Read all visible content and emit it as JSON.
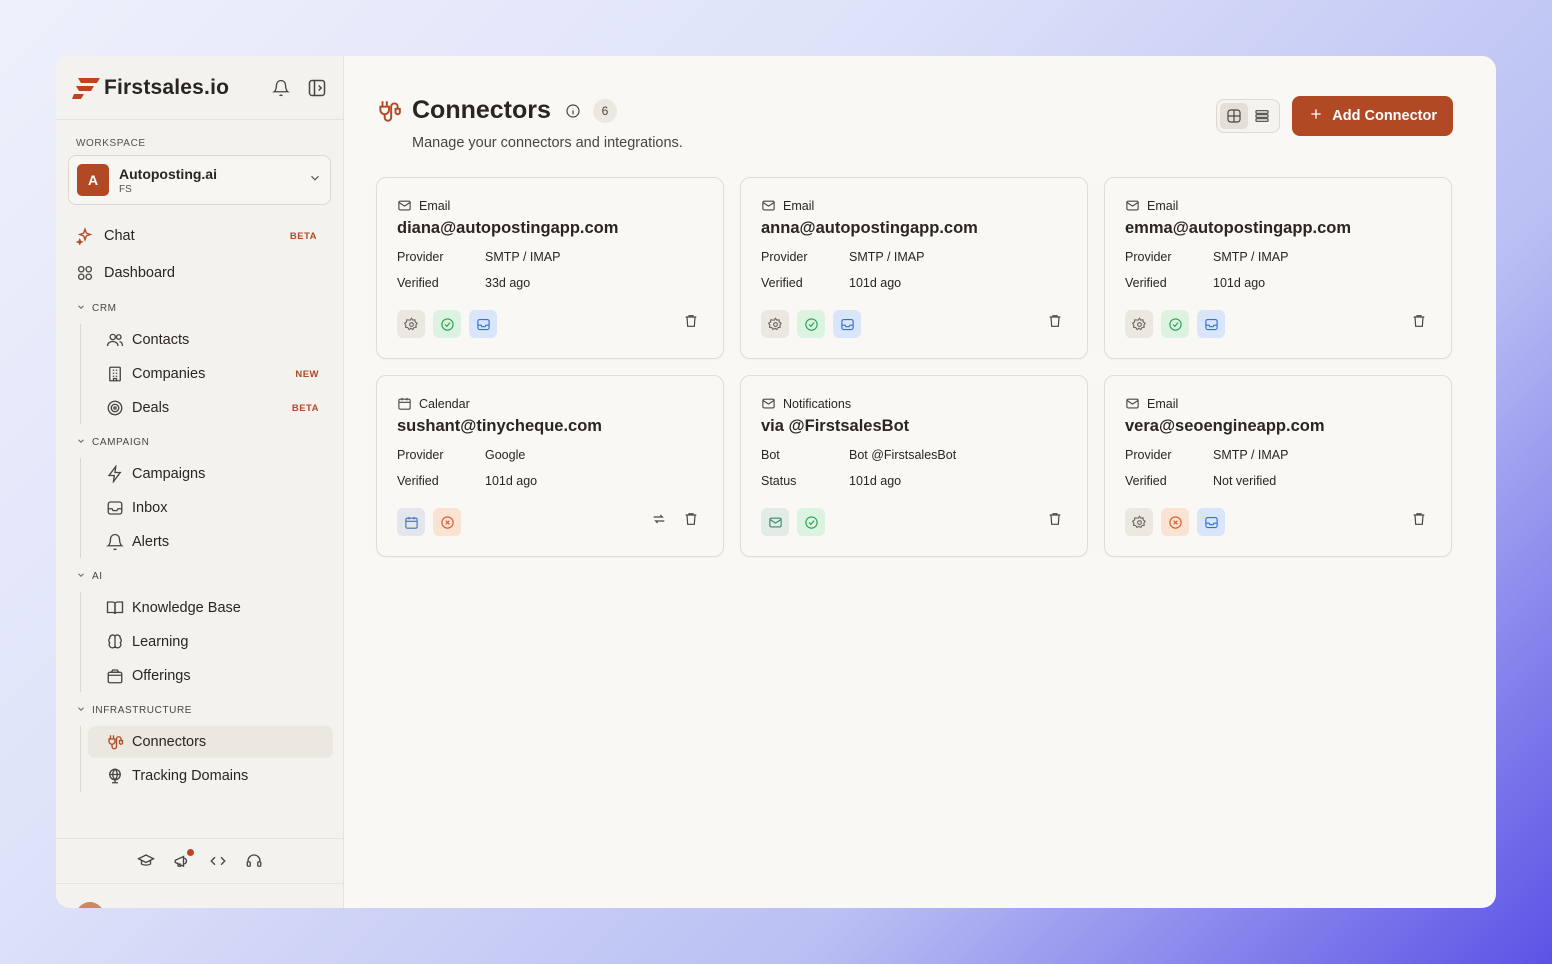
{
  "brand": {
    "name": "Firstsales.io"
  },
  "workspace": {
    "label": "WORKSPACE",
    "avatar_letter": "A",
    "name": "Autoposting.ai",
    "sub": "FS"
  },
  "nav": {
    "chat": {
      "label": "Chat",
      "tag": "BETA"
    },
    "dashboard": {
      "label": "Dashboard"
    },
    "crm": {
      "header": "CRM",
      "items": [
        {
          "label": "Contacts",
          "tag": ""
        },
        {
          "label": "Companies",
          "tag": "NEW"
        },
        {
          "label": "Deals",
          "tag": "BETA"
        }
      ]
    },
    "campaign": {
      "header": "CAMPAIGN",
      "items": [
        {
          "label": "Campaigns"
        },
        {
          "label": "Inbox"
        },
        {
          "label": "Alerts"
        }
      ]
    },
    "ai": {
      "header": "AI",
      "items": [
        {
          "label": "Knowledge Base"
        },
        {
          "label": "Learning"
        },
        {
          "label": "Offerings"
        }
      ]
    },
    "infrastructure": {
      "header": "INFRASTRUCTURE",
      "items": [
        {
          "label": "Connectors"
        },
        {
          "label": "Tracking Domains"
        }
      ]
    }
  },
  "page": {
    "title": "Connectors",
    "count": "6",
    "subtitle": "Manage your connectors and integrations.",
    "add_label": "Add Connector"
  },
  "cards": [
    {
      "type": "Email",
      "ident": "diana@autopostingapp.com",
      "k1": "Provider",
      "v1": "SMTP / IMAP",
      "k2": "Verified",
      "v2": "33d ago"
    },
    {
      "type": "Email",
      "ident": "anna@autopostingapp.com",
      "k1": "Provider",
      "v1": "SMTP / IMAP",
      "k2": "Verified",
      "v2": "101d ago"
    },
    {
      "type": "Email",
      "ident": "emma@autopostingapp.com",
      "k1": "Provider",
      "v1": "SMTP / IMAP",
      "k2": "Verified",
      "v2": "101d ago"
    },
    {
      "type": "Calendar",
      "ident": "sushant@tinycheque.com",
      "k1": "Provider",
      "v1": "Google",
      "k2": "Verified",
      "v2": "101d ago"
    },
    {
      "type": "Notifications",
      "ident": "via @FirstsalesBot",
      "k1": "Bot",
      "v1": "Bot @FirstsalesBot",
      "k2": "Status",
      "v2": "101d ago"
    },
    {
      "type": "Email",
      "ident": "vera@seoengineapp.com",
      "k1": "Provider",
      "v1": "SMTP / IMAP",
      "k2": "Verified",
      "v2": "Not verified"
    }
  ],
  "colors": {
    "accent": "#b14a24",
    "success": "#26a14e",
    "info": "#2f6fd8",
    "danger": "#d0582a"
  }
}
